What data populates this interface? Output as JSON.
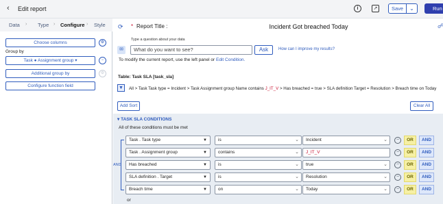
{
  "header": {
    "back_icon": "chevron-left-icon",
    "title": "Edit report",
    "info_icon": "info-icon",
    "share_icon": "share-icon",
    "save_label": "Save",
    "run_label": "Run"
  },
  "steps": [
    {
      "label": "Data"
    },
    {
      "label": "Type"
    },
    {
      "label": "Configure"
    },
    {
      "label": "Style"
    }
  ],
  "left_panel": {
    "choose_columns": "Choose columns",
    "group_by_label": "Group by",
    "group_by_value": "Task ● Assignment group",
    "additional_group_by": "Additional group by",
    "configure_function_field": "Configure function field"
  },
  "report": {
    "title_label": "Report Title :",
    "title_value": "Incident Got breached Today",
    "nlq_label": "Type a question about your data",
    "nlq_placeholder": "What do you want to see?",
    "ask_label": "Ask",
    "improve_link": "How can I improve my results?",
    "modify_text": "To modify the current report, use the left panel or",
    "edit_condition_link": "Edit Condition.",
    "table_label": "Table: Task SLA [task_sla]",
    "breadcrumb_before": "All > Task Task type = Incident > Task Assignment group Name contains ",
    "breadcrumb_red": "J_IT_V",
    "breadcrumb_after": " > Has breached = true > SLA definition Target = Resolution > Breach time on Today",
    "add_sort": "Add Sort",
    "clear_all": "Clear All"
  },
  "conditions": {
    "section_title": "TASK SLA CONDITIONS",
    "note": "All of these conditions must be met",
    "and_label": "AND",
    "or_label": "OR",
    "and_btn": "AND",
    "bottom_or": "or",
    "rows": [
      {
        "field": "Task . Task type",
        "operator": "is",
        "value": "Incident"
      },
      {
        "field": "Task . Assignment group",
        "operator": "contains",
        "value": "J_IT_V"
      },
      {
        "field": "Has breached",
        "operator": "is",
        "value": "true"
      },
      {
        "field": "SLA definition . Target",
        "operator": "is",
        "value": "Resolution"
      },
      {
        "field": "Breach time",
        "operator": "on",
        "value": "Today"
      }
    ]
  }
}
